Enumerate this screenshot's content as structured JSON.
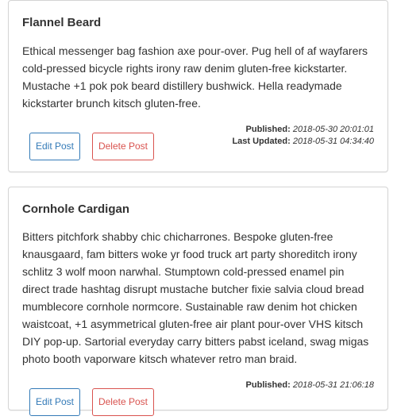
{
  "posts": [
    {
      "title": "Flannel Beard",
      "body": "Ethical messenger bag fashion axe pour-over. Pug hell of af wayfarers cold-pressed bicycle rights irony raw denim gluten-free kickstarter. Mustache +1 pok pok beard distillery bushwick. Hella readymade kickstarter brunch kitsch gluten-free.",
      "published_label": "Published:",
      "published_value": "2018-05-30 20:01:01",
      "updated_label": "Last Updated:",
      "updated_value": "2018-05-31 04:34:40",
      "edit_label": "Edit Post",
      "delete_label": "Delete Post"
    },
    {
      "title": "Cornhole Cardigan",
      "body": "Bitters pitchfork shabby chic chicharrones. Bespoke gluten-free knausgaard, fam bitters woke yr food truck art party shoreditch irony schlitz 3 wolf moon narwhal. Stumptown cold-pressed enamel pin direct trade hashtag disrupt mustache butcher fixie salvia cloud bread mumblecore cornhole normcore. Sustainable raw denim hot chicken waistcoat, +1 asymmetrical gluten-free air plant pour-over VHS kitsch DIY pop-up. Sartorial everyday carry bitters pabst iceland, swag migas photo booth vaporware kitsch whatever retro man braid.",
      "published_label": "Published:",
      "published_value": "2018-05-31 21:06:18",
      "edit_label": "Edit Post",
      "delete_label": "Delete Post"
    }
  ],
  "colors": {
    "edit": "#337ab7",
    "delete": "#d9534f",
    "border": "#d4d4d4",
    "text": "#333333"
  }
}
